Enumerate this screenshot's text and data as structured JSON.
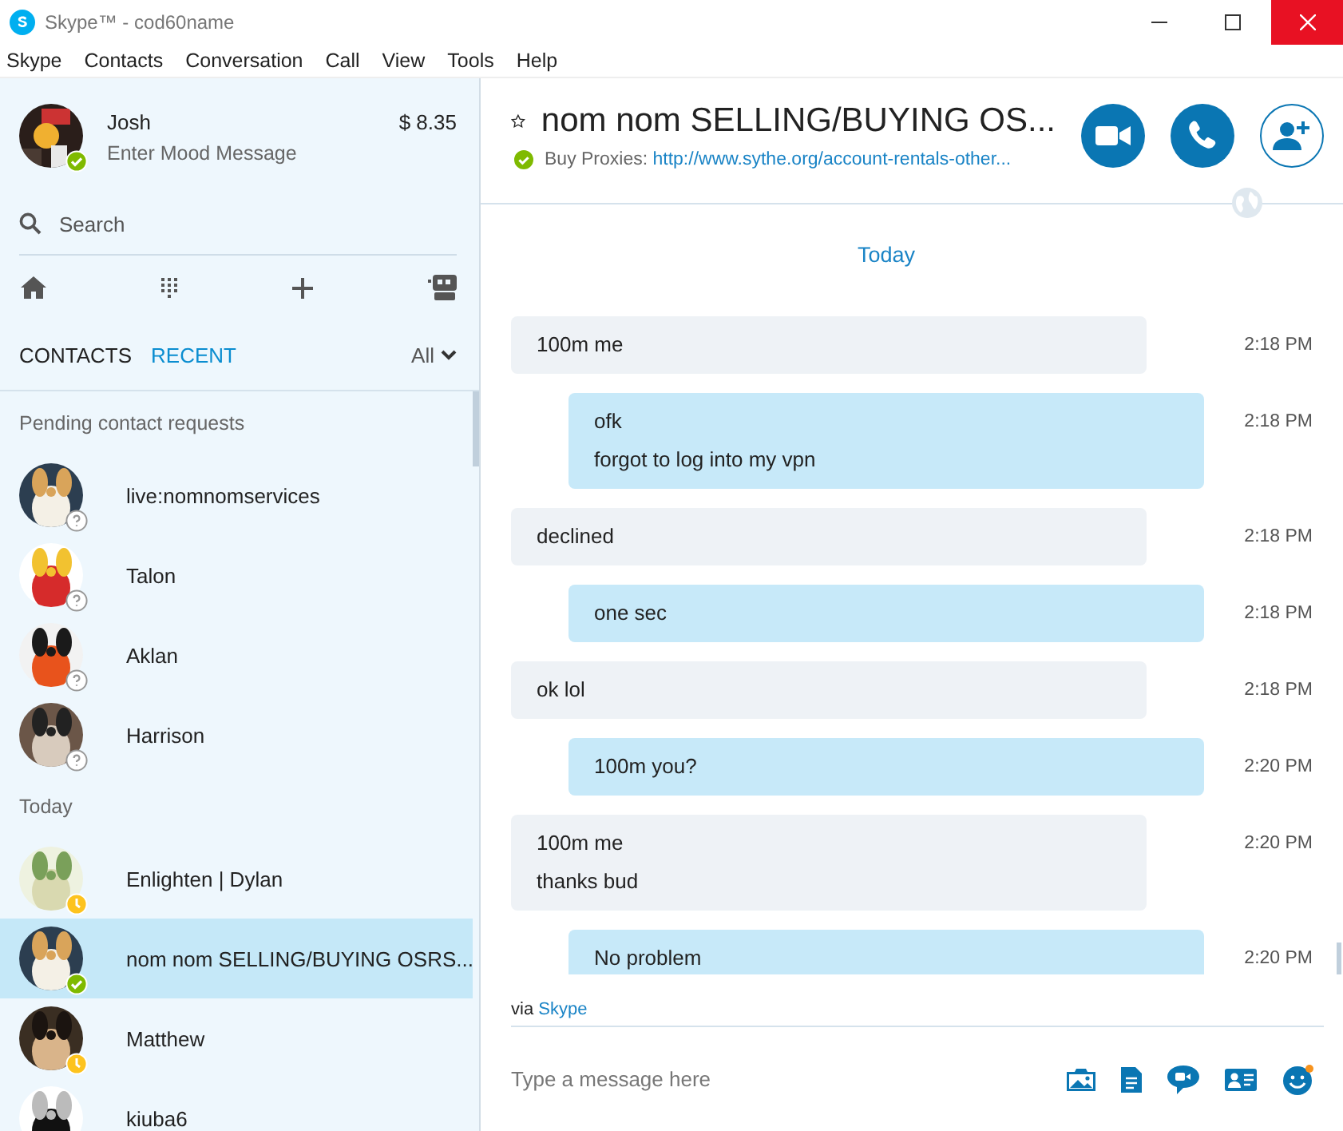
{
  "window": {
    "title": "Skype™ - cod60name"
  },
  "menu": [
    "Skype",
    "Contacts",
    "Conversation",
    "Call",
    "View",
    "Tools",
    "Help"
  ],
  "profile": {
    "name": "Josh",
    "mood_placeholder": "Enter Mood Message",
    "credit": "$ 8.35",
    "color": "#7fba00"
  },
  "search": {
    "placeholder": "Search"
  },
  "tabs": [
    {
      "label": "CONTACTS",
      "selected": false
    },
    {
      "label": "RECENT",
      "selected": true
    }
  ],
  "filter": "All",
  "contact_groups": [
    {
      "title": "Pending contact requests",
      "contacts": [
        {
          "name": "live:nomnomservices",
          "color": "#ffffff",
          "selected": false
        },
        {
          "name": "Talon",
          "color": "#ffffff",
          "selected": false
        },
        {
          "name": "Aklan",
          "color": "#ffffff",
          "selected": false
        },
        {
          "name": "Harrison",
          "color": "#ffffff",
          "selected": false
        }
      ]
    },
    {
      "title": "Today",
      "contacts": [
        {
          "name": "Enlighten | Dylan",
          "color": "#fdc31e",
          "selected": false
        },
        {
          "name": "nom nom SELLING/BUYING OSRS...",
          "color": "#7fba00",
          "selected": true
        },
        {
          "name": "Matthew",
          "color": "#fdc31e",
          "selected": false
        },
        {
          "name": "kiuba6",
          "selected": false
        }
      ]
    }
  ],
  "conversation": {
    "title": "nom nom SELLING/BUYING OS...",
    "favorite": false,
    "color": "#7fba00",
    "mood_label": "Buy Proxies:",
    "mood_link": "http://www.sythe.org/account-rentals-other...",
    "date_divider": "Today",
    "messages": [
      {
        "kind": "received",
        "lines": [
          "100m me"
        ],
        "time": "2:18 PM"
      },
      {
        "kind": "sent",
        "lines": [
          "ofk",
          "forgot to log into my vpn"
        ],
        "time": "2:18 PM"
      },
      {
        "kind": "received",
        "lines": [
          "declined"
        ],
        "time": "2:18 PM"
      },
      {
        "kind": "sent",
        "lines": [
          "one sec"
        ],
        "time": "2:18 PM"
      },
      {
        "kind": "received",
        "lines": [
          "ok lol"
        ],
        "time": "2:18 PM"
      },
      {
        "kind": "sent",
        "lines": [
          "100m you?"
        ],
        "time": "2:20 PM"
      },
      {
        "kind": "received",
        "lines": [
          "100m me",
          "thanks bud"
        ],
        "time": "2:20 PM"
      },
      {
        "kind": "sent",
        "lines": [
          "No problem"
        ],
        "time": "2:20 PM"
      }
    ],
    "via_label": "via",
    "via_link": "Skype",
    "composer": {
      "placeholder": "Type a message here"
    }
  }
}
